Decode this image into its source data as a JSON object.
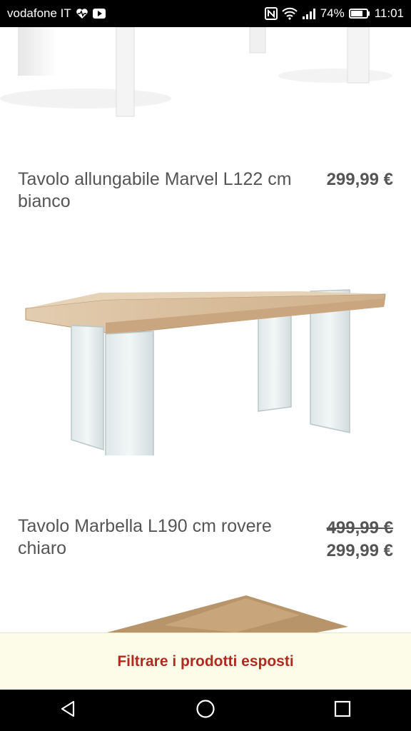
{
  "status_bar": {
    "carrier": "vodafone IT",
    "battery_percent": "74%",
    "time": "11:01",
    "icons": [
      "heart-monitor-icon",
      "media-icon",
      "nfc-icon",
      "wifi-icon",
      "signal-icon",
      "battery-icon"
    ]
  },
  "products": [
    {
      "title": "Tavolo allungabile Marvel L122 cm bianco",
      "price": "299,99 €"
    },
    {
      "title": "Tavolo Marbella L190 cm rovere chiaro",
      "old_price": "499,99 €",
      "price": "299,99 €"
    }
  ],
  "filter_bar": {
    "label": "Filtrare i prodotti esposti"
  },
  "nav_bar": {
    "icons": [
      "back-icon",
      "home-icon",
      "recents-icon"
    ]
  },
  "colors": {
    "filter_text": "#b12a1e",
    "filter_bg": "#fdfce9",
    "text": "#555555"
  }
}
